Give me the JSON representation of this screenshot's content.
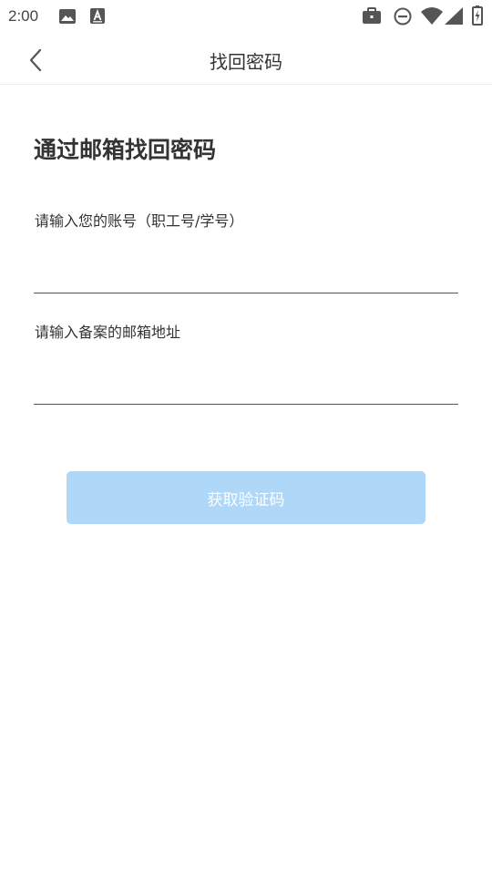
{
  "status_bar": {
    "time": "2:00",
    "icons": [
      "image-icon",
      "font-a-icon",
      "briefcase-icon",
      "do-not-disturb-icon",
      "wifi-icon",
      "signal-icon",
      "battery-charging-icon"
    ]
  },
  "header": {
    "back_icon": "chevron-left-icon",
    "title": "找回密码"
  },
  "main": {
    "heading": "通过邮箱找回密码",
    "account_field": {
      "label": "请输入您的账号（职工号/学号）",
      "value": ""
    },
    "email_field": {
      "label": "请输入备案的邮箱地址",
      "value": ""
    },
    "send_code_button": {
      "label": "获取验证码",
      "disabled": true
    }
  },
  "colors": {
    "button_bg": "#aed7f8",
    "text": "#333333",
    "underline": "#555555"
  }
}
